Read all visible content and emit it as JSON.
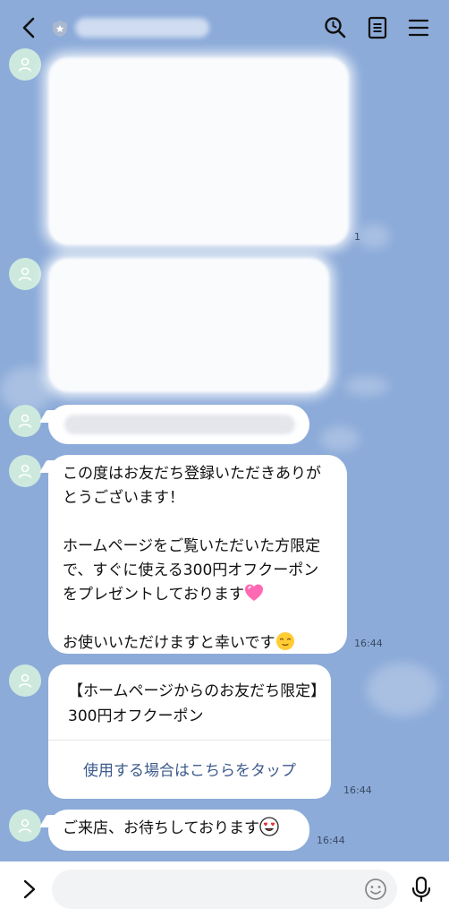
{
  "chat": {
    "title": "",
    "messages": [
      {
        "type": "hidden",
        "read": "1"
      },
      {
        "type": "hidden"
      },
      {
        "type": "hidden"
      },
      {
        "type": "text",
        "text": "この度はお友だち登録いただきありがとうございます！\n\nホームページをご覧いただいた方限定で、すぐに使える300円オフクーポンをプレゼントしております",
        "text2": "お使いいただけますと幸いです",
        "time": "16:44"
      },
      {
        "type": "coupon",
        "title": "【ホームページからのお友だち限定】300円オフクーポン",
        "link": "使用する場合はこちらをタップ",
        "time": "16:44"
      },
      {
        "type": "text",
        "text": "ご来店、お待ちしております",
        "time": "16:44"
      }
    ]
  },
  "icons": {
    "back": "chevron-left-icon",
    "search": "search-icon",
    "notes": "notes-icon",
    "menu": "menu-icon",
    "expand": "chevron-right-icon",
    "emoji": "smiley-icon",
    "mic": "microphone-icon"
  },
  "colors": {
    "background": "#8cabd9",
    "avatar": "#cde9de",
    "link": "#3d5a8c"
  }
}
